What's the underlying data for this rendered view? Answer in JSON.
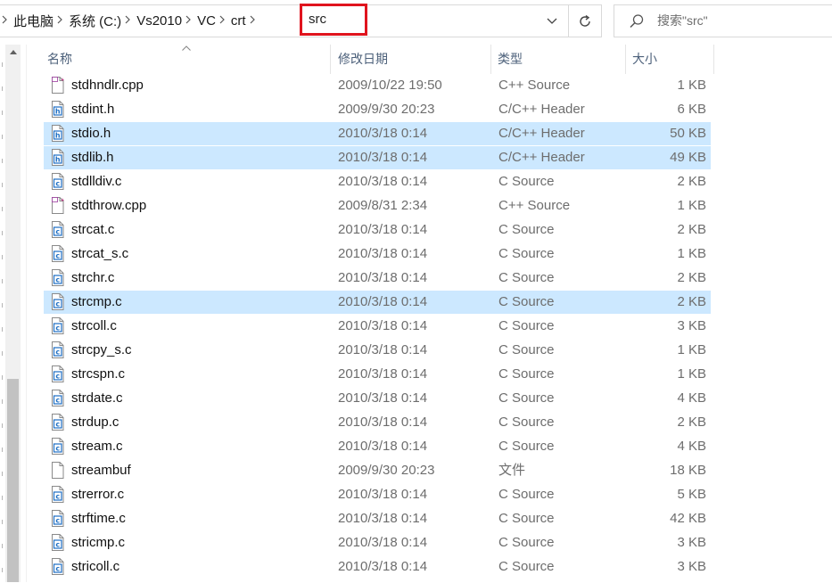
{
  "address_bar": {
    "breadcrumbs": [
      "此电脑",
      "系统 (C:)",
      "Vs2010",
      "VC",
      "crt"
    ],
    "current": "src",
    "highlight_color": "#e0141e"
  },
  "search": {
    "placeholder": "搜索\"src\""
  },
  "columns": {
    "name": "名称",
    "date": "修改日期",
    "type": "类型",
    "size": "大小"
  },
  "colors": {
    "selection": "#cce8ff",
    "header_text": "#4c607a",
    "secondary_text": "#6d6d6d",
    "c_icon": "#1e6fc4"
  },
  "files": [
    {
      "name": "stdhndlr.cpp",
      "date": "2009/10/22 19:50",
      "type": "C++ Source",
      "size": "1 KB",
      "icon": "cpp-file-icon",
      "selected": false
    },
    {
      "name": "stdint.h",
      "date": "2009/9/30 20:23",
      "type": "C/C++ Header",
      "size": "6 KB",
      "icon": "h-file-icon",
      "selected": false
    },
    {
      "name": "stdio.h",
      "date": "2010/3/18 0:14",
      "type": "C/C++ Header",
      "size": "50 KB",
      "icon": "h-file-icon",
      "selected": true
    },
    {
      "name": "stdlib.h",
      "date": "2010/3/18 0:14",
      "type": "C/C++ Header",
      "size": "49 KB",
      "icon": "h-file-icon",
      "selected": true
    },
    {
      "name": "stdlldiv.c",
      "date": "2010/3/18 0:14",
      "type": "C Source",
      "size": "2 KB",
      "icon": "c-file-icon",
      "selected": false
    },
    {
      "name": "stdthrow.cpp",
      "date": "2009/8/31 2:34",
      "type": "C++ Source",
      "size": "1 KB",
      "icon": "cpp-file-icon",
      "selected": false
    },
    {
      "name": "strcat.c",
      "date": "2010/3/18 0:14",
      "type": "C Source",
      "size": "2 KB",
      "icon": "c-file-icon",
      "selected": false
    },
    {
      "name": "strcat_s.c",
      "date": "2010/3/18 0:14",
      "type": "C Source",
      "size": "1 KB",
      "icon": "c-file-icon",
      "selected": false
    },
    {
      "name": "strchr.c",
      "date": "2010/3/18 0:14",
      "type": "C Source",
      "size": "2 KB",
      "icon": "c-file-icon",
      "selected": false
    },
    {
      "name": "strcmp.c",
      "date": "2010/3/18 0:14",
      "type": "C Source",
      "size": "2 KB",
      "icon": "c-file-icon",
      "selected": true
    },
    {
      "name": "strcoll.c",
      "date": "2010/3/18 0:14",
      "type": "C Source",
      "size": "3 KB",
      "icon": "c-file-icon",
      "selected": false
    },
    {
      "name": "strcpy_s.c",
      "date": "2010/3/18 0:14",
      "type": "C Source",
      "size": "1 KB",
      "icon": "c-file-icon",
      "selected": false
    },
    {
      "name": "strcspn.c",
      "date": "2010/3/18 0:14",
      "type": "C Source",
      "size": "1 KB",
      "icon": "c-file-icon",
      "selected": false
    },
    {
      "name": "strdate.c",
      "date": "2010/3/18 0:14",
      "type": "C Source",
      "size": "4 KB",
      "icon": "c-file-icon",
      "selected": false
    },
    {
      "name": "strdup.c",
      "date": "2010/3/18 0:14",
      "type": "C Source",
      "size": "2 KB",
      "icon": "c-file-icon",
      "selected": false
    },
    {
      "name": "stream.c",
      "date": "2010/3/18 0:14",
      "type": "C Source",
      "size": "4 KB",
      "icon": "c-file-icon",
      "selected": false
    },
    {
      "name": "streambuf",
      "date": "2009/9/30 20:23",
      "type": "文件",
      "size": "18 KB",
      "icon": "blank-file-icon",
      "selected": false
    },
    {
      "name": "strerror.c",
      "date": "2010/3/18 0:14",
      "type": "C Source",
      "size": "5 KB",
      "icon": "c-file-icon",
      "selected": false
    },
    {
      "name": "strftime.c",
      "date": "2010/3/18 0:14",
      "type": "C Source",
      "size": "42 KB",
      "icon": "c-file-icon",
      "selected": false
    },
    {
      "name": "stricmp.c",
      "date": "2010/3/18 0:14",
      "type": "C Source",
      "size": "3 KB",
      "icon": "c-file-icon",
      "selected": false
    },
    {
      "name": "stricoll.c",
      "date": "2010/3/18 0:14",
      "type": "C Source",
      "size": "3 KB",
      "icon": "c-file-icon",
      "selected": false
    }
  ]
}
